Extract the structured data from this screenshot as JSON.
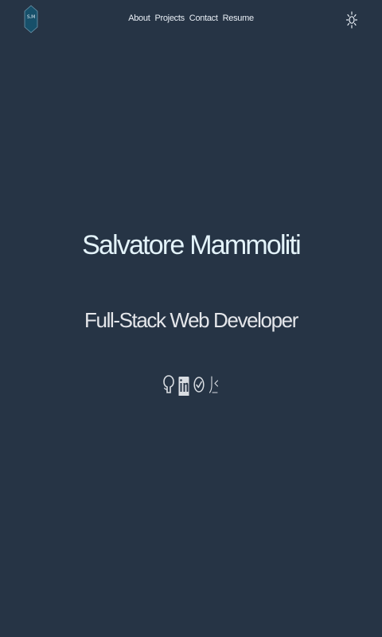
{
  "header": {
    "logo_text": "S.M",
    "nav": [
      {
        "label": "About"
      },
      {
        "label": "Projects"
      },
      {
        "label": "Contact"
      },
      {
        "label": "Resume"
      }
    ],
    "theme_toggle_icon": "sun-icon"
  },
  "hero": {
    "name": "Salvatore Mammoliti",
    "title": "Full-Stack Web Developer"
  },
  "socials": [
    {
      "icon": "github-icon"
    },
    {
      "icon": "linkedin-icon"
    },
    {
      "icon": "check-circle-icon"
    },
    {
      "icon": "code-icon"
    }
  ],
  "colors": {
    "background": "#263445",
    "logo_fill": "#17506a",
    "name_text": "#e3f3fa",
    "title_text": "#e4e6ea",
    "icon_color": "#d9dde2"
  }
}
